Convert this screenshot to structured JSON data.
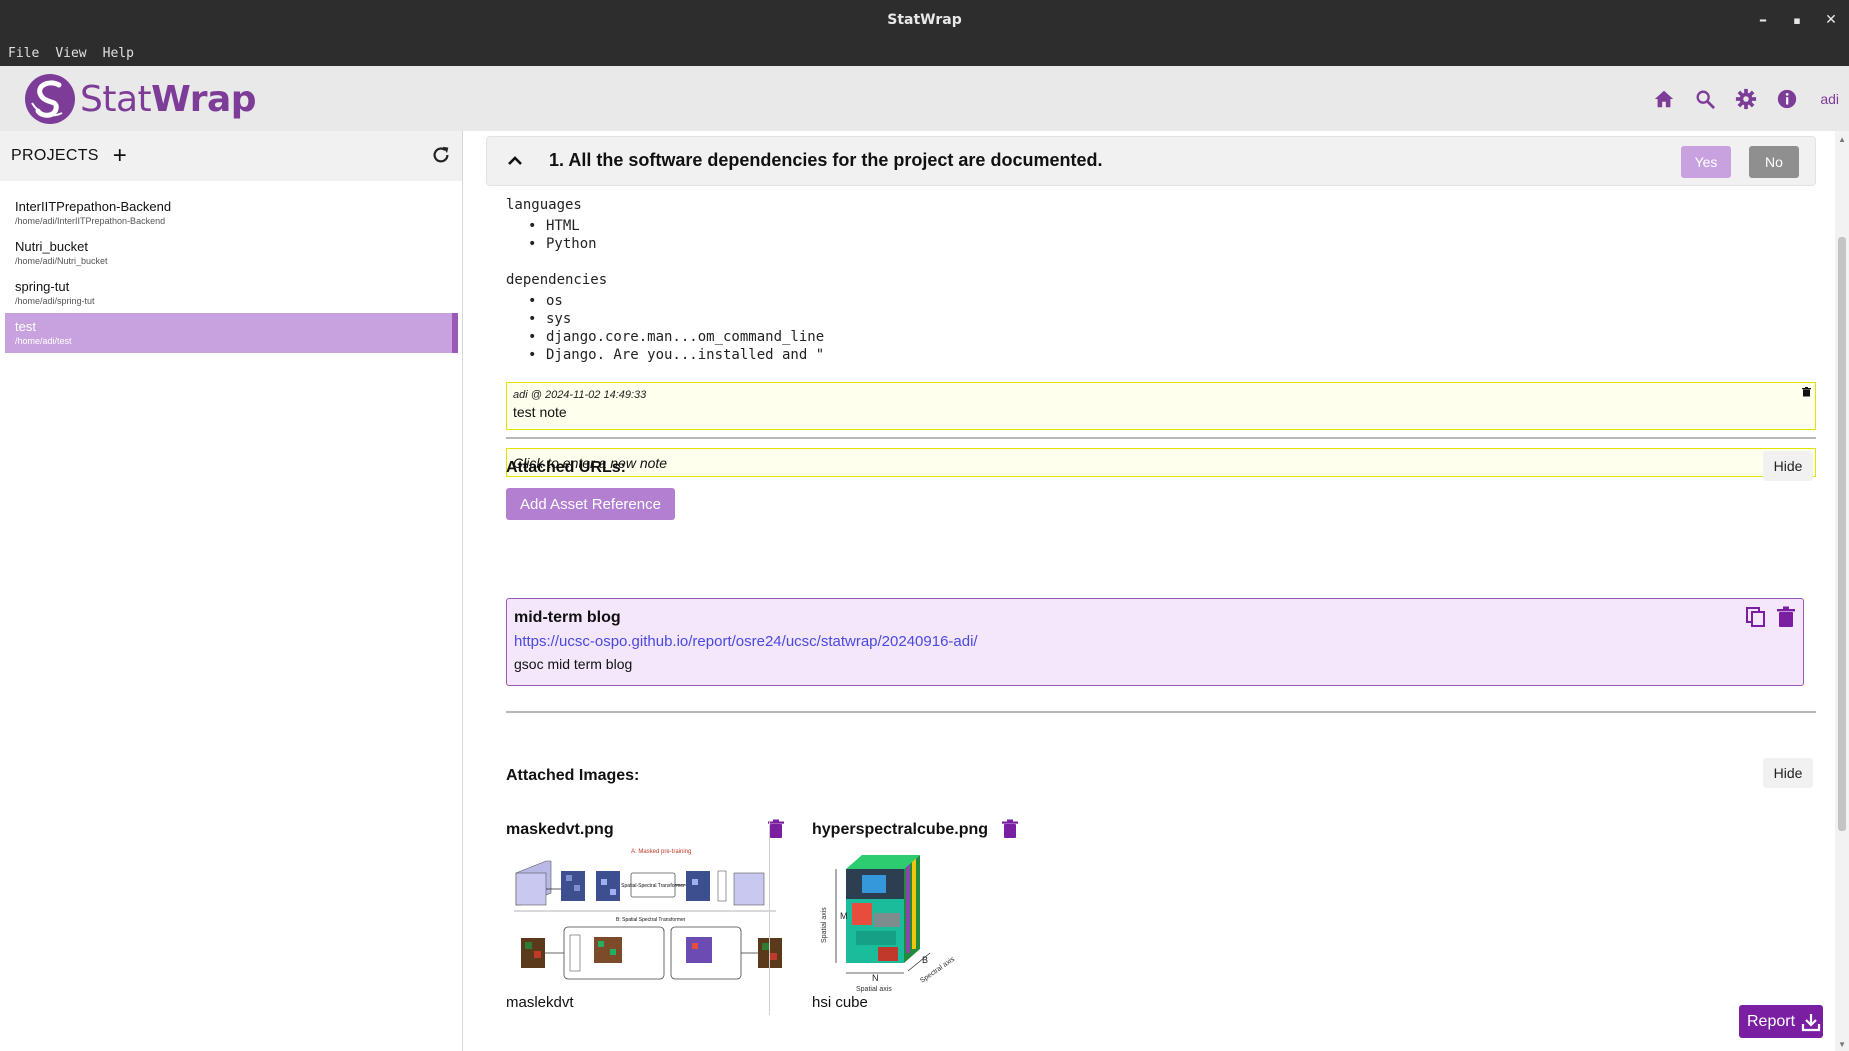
{
  "window": {
    "title": "StatWrap",
    "controls": {
      "minimize": "–",
      "maximize": "▪",
      "close": "✕"
    }
  },
  "menubar": {
    "items": [
      "File",
      "View",
      "Help"
    ]
  },
  "header": {
    "logo_text_light": "Stat",
    "logo_text_bold": "Wrap",
    "icons": [
      "home-icon",
      "search-icon",
      "gear-icon",
      "info-icon"
    ],
    "user": "adi",
    "accent_color": "#7d3c98"
  },
  "sidebar": {
    "title": "PROJECTS",
    "add_symbol": "+",
    "projects": [
      {
        "name": "InterIITPrepathon-Backend",
        "path": "/home/adi/InterIITPrepathon-Backend",
        "selected": false
      },
      {
        "name": "Nutri_bucket",
        "path": "/home/adi/Nutri_bucket",
        "selected": false
      },
      {
        "name": "spring-tut",
        "path": "/home/adi/spring-tut",
        "selected": false
      },
      {
        "name": "test",
        "path": "/home/adi/test",
        "selected": true
      }
    ]
  },
  "checklist": {
    "question": "1. All the software dependencies for the project are documented.",
    "yes_label": "Yes",
    "no_label": "No",
    "languages_label": "languages",
    "languages": [
      "HTML",
      "Python"
    ],
    "dependencies_label": "dependencies",
    "dependencies": [
      "os",
      "sys",
      "django.core.man...om_command_line",
      "Django. Are you...installed and \""
    ],
    "note": {
      "meta": "adi @ 2024-11-02 14:49:33",
      "text": "test note"
    },
    "new_note_placeholder": "Click to enter a new note",
    "add_asset_label": "Add Asset Reference"
  },
  "urls": {
    "title": "Attached URLs:",
    "hide_label": "Hide",
    "items": [
      {
        "title": "mid-term blog",
        "url": "https://ucsc-ospo.github.io/report/osre24/ucsc/statwrap/20240916-adi/",
        "description": "gsoc mid term blog"
      }
    ]
  },
  "images": {
    "title": "Attached Images:",
    "hide_label": "Hide",
    "items": [
      {
        "name": "maskedvt.png",
        "caption": "maslekdvt",
        "figure_text": {
          "top": "A: Masked pre-training",
          "mid": "Spatial-Spectral Transformer",
          "bottom": "B: Spatial Spectral Transformer"
        }
      },
      {
        "name": "hyperspectralcube.png",
        "caption": "hsi cube",
        "figure_text": {
          "y_axis": "Spatial axis",
          "x_axis": "Spatial axis",
          "z_axis": "Spectral axis",
          "m": "M",
          "n": "N",
          "b": "B"
        }
      }
    ]
  },
  "report_button": {
    "label": "Report"
  }
}
